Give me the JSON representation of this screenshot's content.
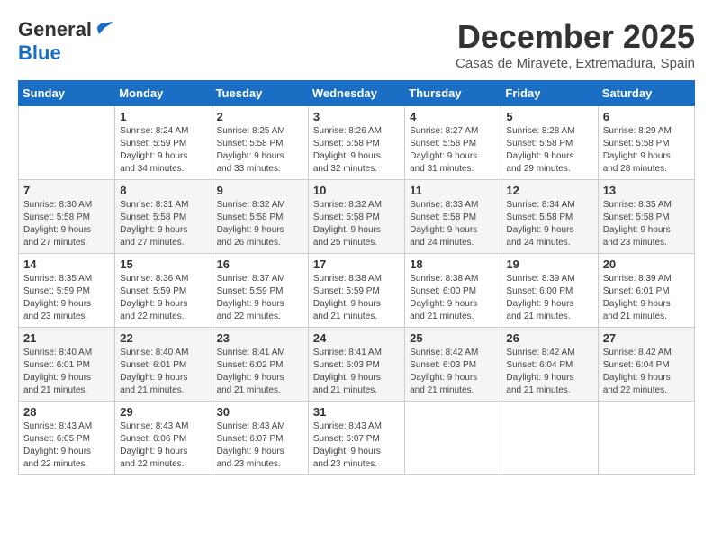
{
  "logo": {
    "general": "General",
    "blue": "Blue"
  },
  "title": {
    "month_year": "December 2025",
    "location": "Casas de Miravete, Extremadura, Spain"
  },
  "headers": [
    "Sunday",
    "Monday",
    "Tuesday",
    "Wednesday",
    "Thursday",
    "Friday",
    "Saturday"
  ],
  "weeks": [
    [
      {
        "day": "",
        "info": ""
      },
      {
        "day": "1",
        "info": "Sunrise: 8:24 AM\nSunset: 5:59 PM\nDaylight: 9 hours\nand 34 minutes."
      },
      {
        "day": "2",
        "info": "Sunrise: 8:25 AM\nSunset: 5:58 PM\nDaylight: 9 hours\nand 33 minutes."
      },
      {
        "day": "3",
        "info": "Sunrise: 8:26 AM\nSunset: 5:58 PM\nDaylight: 9 hours\nand 32 minutes."
      },
      {
        "day": "4",
        "info": "Sunrise: 8:27 AM\nSunset: 5:58 PM\nDaylight: 9 hours\nand 31 minutes."
      },
      {
        "day": "5",
        "info": "Sunrise: 8:28 AM\nSunset: 5:58 PM\nDaylight: 9 hours\nand 29 minutes."
      },
      {
        "day": "6",
        "info": "Sunrise: 8:29 AM\nSunset: 5:58 PM\nDaylight: 9 hours\nand 28 minutes."
      }
    ],
    [
      {
        "day": "7",
        "info": "Sunrise: 8:30 AM\nSunset: 5:58 PM\nDaylight: 9 hours\nand 27 minutes."
      },
      {
        "day": "8",
        "info": "Sunrise: 8:31 AM\nSunset: 5:58 PM\nDaylight: 9 hours\nand 27 minutes."
      },
      {
        "day": "9",
        "info": "Sunrise: 8:32 AM\nSunset: 5:58 PM\nDaylight: 9 hours\nand 26 minutes."
      },
      {
        "day": "10",
        "info": "Sunrise: 8:32 AM\nSunset: 5:58 PM\nDaylight: 9 hours\nand 25 minutes."
      },
      {
        "day": "11",
        "info": "Sunrise: 8:33 AM\nSunset: 5:58 PM\nDaylight: 9 hours\nand 24 minutes."
      },
      {
        "day": "12",
        "info": "Sunrise: 8:34 AM\nSunset: 5:58 PM\nDaylight: 9 hours\nand 24 minutes."
      },
      {
        "day": "13",
        "info": "Sunrise: 8:35 AM\nSunset: 5:58 PM\nDaylight: 9 hours\nand 23 minutes."
      }
    ],
    [
      {
        "day": "14",
        "info": "Sunrise: 8:35 AM\nSunset: 5:59 PM\nDaylight: 9 hours\nand 23 minutes."
      },
      {
        "day": "15",
        "info": "Sunrise: 8:36 AM\nSunset: 5:59 PM\nDaylight: 9 hours\nand 22 minutes."
      },
      {
        "day": "16",
        "info": "Sunrise: 8:37 AM\nSunset: 5:59 PM\nDaylight: 9 hours\nand 22 minutes."
      },
      {
        "day": "17",
        "info": "Sunrise: 8:38 AM\nSunset: 5:59 PM\nDaylight: 9 hours\nand 21 minutes."
      },
      {
        "day": "18",
        "info": "Sunrise: 8:38 AM\nSunset: 6:00 PM\nDaylight: 9 hours\nand 21 minutes."
      },
      {
        "day": "19",
        "info": "Sunrise: 8:39 AM\nSunset: 6:00 PM\nDaylight: 9 hours\nand 21 minutes."
      },
      {
        "day": "20",
        "info": "Sunrise: 8:39 AM\nSunset: 6:01 PM\nDaylight: 9 hours\nand 21 minutes."
      }
    ],
    [
      {
        "day": "21",
        "info": "Sunrise: 8:40 AM\nSunset: 6:01 PM\nDaylight: 9 hours\nand 21 minutes."
      },
      {
        "day": "22",
        "info": "Sunrise: 8:40 AM\nSunset: 6:01 PM\nDaylight: 9 hours\nand 21 minutes."
      },
      {
        "day": "23",
        "info": "Sunrise: 8:41 AM\nSunset: 6:02 PM\nDaylight: 9 hours\nand 21 minutes."
      },
      {
        "day": "24",
        "info": "Sunrise: 8:41 AM\nSunset: 6:03 PM\nDaylight: 9 hours\nand 21 minutes."
      },
      {
        "day": "25",
        "info": "Sunrise: 8:42 AM\nSunset: 6:03 PM\nDaylight: 9 hours\nand 21 minutes."
      },
      {
        "day": "26",
        "info": "Sunrise: 8:42 AM\nSunset: 6:04 PM\nDaylight: 9 hours\nand 21 minutes."
      },
      {
        "day": "27",
        "info": "Sunrise: 8:42 AM\nSunset: 6:04 PM\nDaylight: 9 hours\nand 22 minutes."
      }
    ],
    [
      {
        "day": "28",
        "info": "Sunrise: 8:43 AM\nSunset: 6:05 PM\nDaylight: 9 hours\nand 22 minutes."
      },
      {
        "day": "29",
        "info": "Sunrise: 8:43 AM\nSunset: 6:06 PM\nDaylight: 9 hours\nand 22 minutes."
      },
      {
        "day": "30",
        "info": "Sunrise: 8:43 AM\nSunset: 6:07 PM\nDaylight: 9 hours\nand 23 minutes."
      },
      {
        "day": "31",
        "info": "Sunrise: 8:43 AM\nSunset: 6:07 PM\nDaylight: 9 hours\nand 23 minutes."
      },
      {
        "day": "",
        "info": ""
      },
      {
        "day": "",
        "info": ""
      },
      {
        "day": "",
        "info": ""
      }
    ]
  ]
}
